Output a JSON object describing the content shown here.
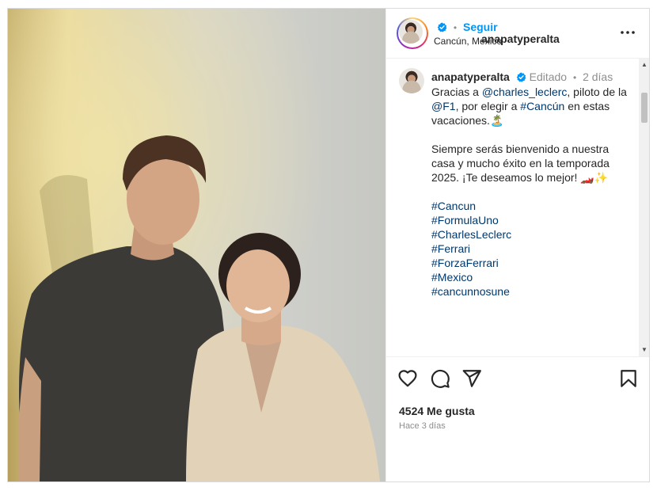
{
  "post": {
    "username": "anapatyperalta",
    "follow_label": "Seguir",
    "location": "Cancún, Mexico",
    "separator": "•"
  },
  "caption": {
    "username": "anapatyperalta",
    "edited_label": "Editado",
    "separator": "•",
    "time": "2 días",
    "p1_before": "Gracias a ",
    "p1_mention1": "@charles_leclerc",
    "p1_mid1": ", piloto de la ",
    "p1_mention2": "@F1",
    "p1_mid2": ", por elegir a ",
    "p1_hashtag": "#Cancún",
    "p1_after": " en estas vacaciones.",
    "p1_emoji": "🏝️",
    "p2_text": "Siempre serás bienvenido a nuestra casa y mucho éxito en la temporada 2025. ¡Te deseamos lo mejor!",
    "p2_emoji": "🏎️✨",
    "hashtags": [
      "#Cancun",
      "#FormulaUno",
      "#CharlesLeclerc",
      "#Ferrari",
      "#ForzaFerrari",
      "#Mexico",
      "#cancunnosune"
    ]
  },
  "footer": {
    "likes_label": "4524 Me gusta",
    "posted_ago": "Hace 3 días"
  },
  "icons": {
    "verified": "verified-badge-icon",
    "more": "more-options-icon",
    "like": "heart-icon",
    "comment": "comment-icon",
    "share": "paper-plane-icon",
    "save": "bookmark-icon"
  },
  "colors": {
    "link": "#00376b",
    "follow": "#0095f6",
    "verified": "#0095f6",
    "muted": "#8e8e8e"
  }
}
